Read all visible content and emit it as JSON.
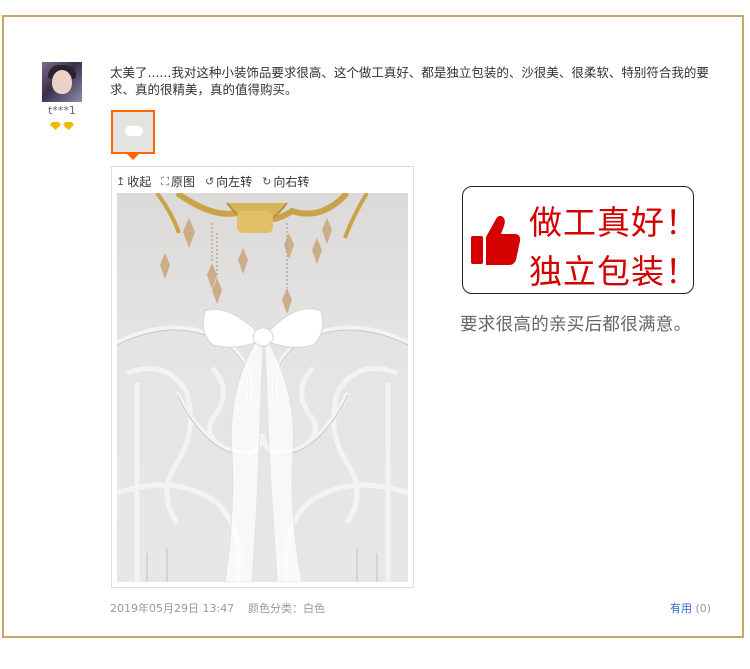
{
  "review": {
    "username": "t***1",
    "text": "太美了......我对这种小装饰品要求很高、这个做工真好、都是独立包装的、沙很美、很柔软、特别符合我的要求、真的很精美，真的值得购买。",
    "date": "2019年05月29日 13:47",
    "color_label": "颜色分类：白色",
    "useful_label": "有用",
    "useful_count": "(0)"
  },
  "viewer": {
    "collapse": "收起",
    "original": "原图",
    "rotate_left": "向左转",
    "rotate_right": "向右转"
  },
  "promo": {
    "line1": "做工真好！",
    "line2": "独立包装！",
    "subtitle": "要求很高的亲买后都很满意。"
  },
  "colors": {
    "frame": "#c9a862",
    "accent": "#d40000",
    "thumb_border": "#ff6600",
    "link": "#3366cc"
  },
  "icons": {
    "collapse": "collapse-up-icon",
    "original": "expand-icon",
    "rotate_left": "rotate-left-icon",
    "rotate_right": "rotate-right-icon",
    "promo": "thumbs-up-icon",
    "badge": "diamond-icon"
  }
}
